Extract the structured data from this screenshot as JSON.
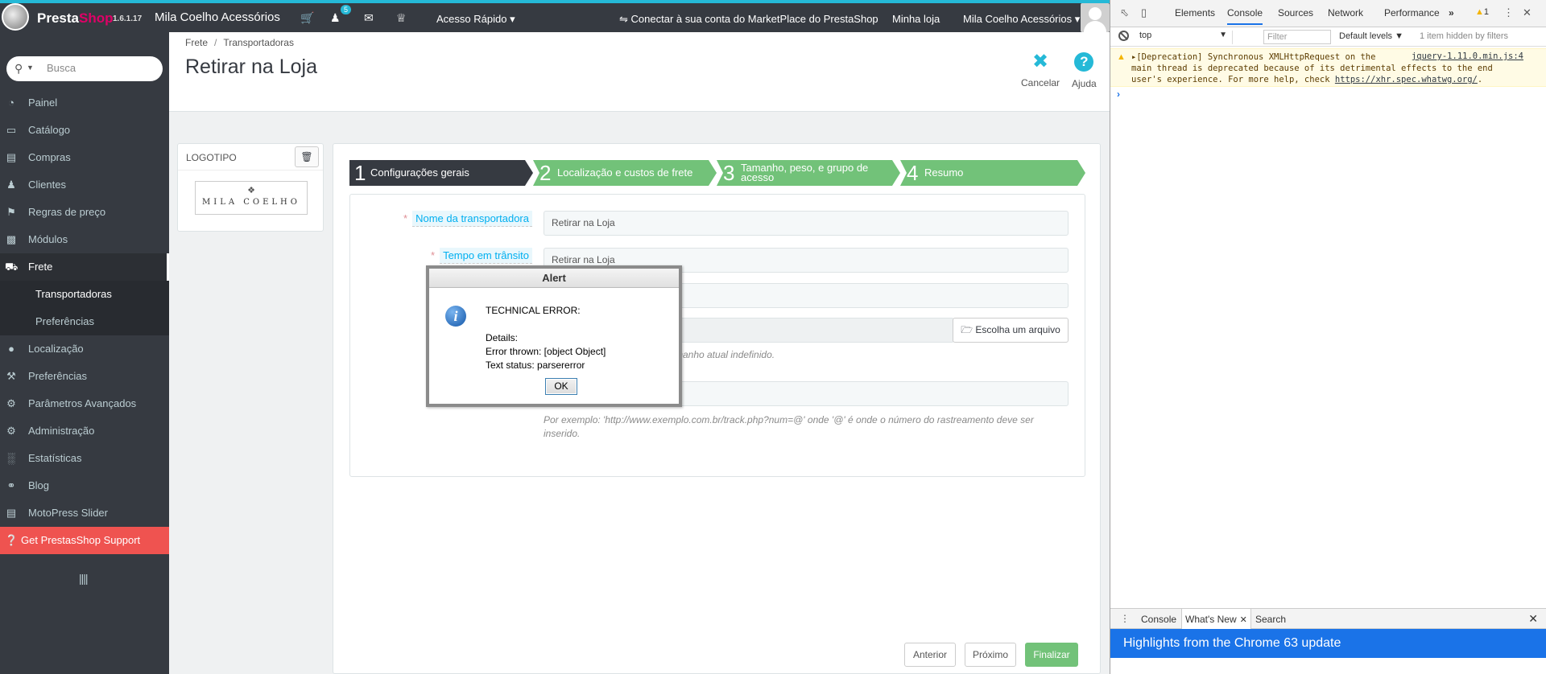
{
  "topbar": {
    "brand_first": "Presta",
    "brand_second": "Shop",
    "version": "1.6.1.17",
    "shop_name": "Mila Coelho Acessórios",
    "icons": [
      "cart-icon",
      "user-icon",
      "envelope-icon",
      "trophy-icon"
    ],
    "notification_count": "5",
    "quick_access": "Acesso Rápido",
    "marketplace_link": "Conectar à sua conta do MarketPlace do PrestaShop",
    "my_shop": "Minha loja",
    "employee": "Mila Coelho Acessórios"
  },
  "sidebar": {
    "search_placeholder": "Busca",
    "items": [
      {
        "label": "Painel",
        "icon": "dashboard-icon"
      },
      {
        "label": "Catálogo",
        "icon": "book-icon"
      },
      {
        "label": "Compras",
        "icon": "credit-card-icon"
      },
      {
        "label": "Clientes",
        "icon": "users-icon"
      },
      {
        "label": "Regras de preço",
        "icon": "tags-icon"
      },
      {
        "label": "Módulos",
        "icon": "puzzle-icon"
      },
      {
        "label": "Frete",
        "icon": "truck-icon"
      },
      {
        "label": "Localização",
        "icon": "globe-icon"
      },
      {
        "label": "Preferências",
        "icon": "wrench-icon"
      },
      {
        "label": "Parâmetros Avançados",
        "icon": "cogs-icon"
      },
      {
        "label": "Administração",
        "icon": "cog-icon"
      },
      {
        "label": "Estatísticas",
        "icon": "bar-chart-icon"
      },
      {
        "label": "Blog",
        "icon": "comment-icon"
      },
      {
        "label": "MotoPress Slider",
        "icon": "desktop-icon"
      }
    ],
    "sub_items": [
      "Transportadoras",
      "Preferências"
    ],
    "support": "Get PrestasShop Support"
  },
  "header": {
    "breadcrumb": [
      "Frete",
      "Transportadoras"
    ],
    "title": "Retirar na Loja",
    "cancel": "Cancelar",
    "help": "Ajuda"
  },
  "logo_panel": {
    "title": "LOGOTIPO",
    "logo_text": "MILA COELHO"
  },
  "wizard": {
    "steps": [
      {
        "num": "1",
        "label": "Configurações gerais",
        "color": "#363a41"
      },
      {
        "num": "2",
        "label": "Localização e custos de frete",
        "color": "#72c279"
      },
      {
        "num": "3",
        "label": "Tamanho, peso, e grupo de acesso",
        "color": "#72c279"
      },
      {
        "num": "4",
        "label": "Resumo",
        "color": "#72c279"
      }
    ],
    "carrier_name_label": "Nome da transportadora",
    "carrier_name_value": "Retirar na Loja",
    "transit_label": "Tempo em trânsito",
    "transit_value": "Retirar na Loja",
    "file_button": "Escolha um arquivo",
    "file_help": "no do arquivo 8.00 Máx MB Tamanho atual indefinido.",
    "tracking_help": "Por exemplo: 'http://www.exemplo.com.br/track.php?num=@' onde '@' é onde o número do rastreamento deve ser inserido.",
    "prev": "Anterior",
    "next": "Próximo",
    "finish": "Finalizar"
  },
  "alert": {
    "title": "Alert",
    "line1": "TECHNICAL ERROR:",
    "line2": "Details:",
    "line3": "Error thrown: [object Object]",
    "line4": "Text status: parsererror",
    "ok": "OK"
  },
  "devtools": {
    "tabs": [
      "Elements",
      "Console",
      "Sources",
      "Network",
      "Performance"
    ],
    "more": "»",
    "warning_count": "1",
    "context": "top",
    "filter_placeholder": "Filter",
    "levels": "Default levels",
    "hidden": "1 item hidden by filters",
    "message": "[Deprecation] Synchronous XMLHttpRequest on the\nmain thread is deprecated because of its detrimental effects to the end\nuser's experience. For more help, check ",
    "message_link": "https://xhr.spec.whatwg.org/",
    "source": "jquery-1.11.0.min.js:4",
    "drawer_tabs": [
      "Console",
      "What's New",
      "Search"
    ],
    "whats_new": "Highlights from the Chrome 63 update",
    "accent": "#1a73e8"
  }
}
